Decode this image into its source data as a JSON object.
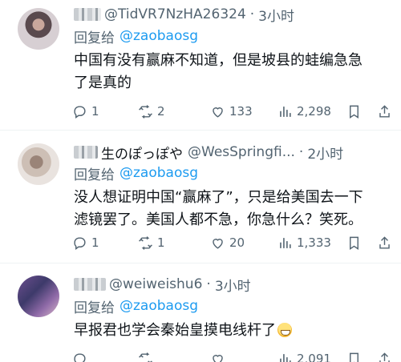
{
  "tweets": [
    {
      "display_name": "",
      "handle": "@TidVR7NzHA26324",
      "dot": "·",
      "time": "3小时",
      "reply_prefix": "回复给",
      "reply_to": "@zaobaosg",
      "text_line1": "中国有没有赢麻不知道，但是坡县的蛙编急急",
      "text_line2": "了是真的",
      "replies": "1",
      "retweets": "2",
      "likes": "133",
      "views": "2,298"
    },
    {
      "display_name": "生のぽっぽや",
      "handle": "@WesSpringfi...",
      "dot": "·",
      "time": "2小时",
      "reply_prefix": "回复给",
      "reply_to": "@zaobaosg",
      "text_line1": "没人想证明中国“赢麻了”，只是给美国去一下",
      "text_line2": "滤镜罢了。美国人都不急，你急什么？笑死。",
      "replies": "1",
      "retweets": "1",
      "likes": "20",
      "views": "1,333"
    },
    {
      "display_name": "",
      "handle": "@weiweishu6",
      "dot": "·",
      "time": "3小时",
      "reply_prefix": "回复给",
      "reply_to": "@zaobaosg",
      "text_line1": "早报君也学会秦始皇摸电线杆了",
      "text_line2": "",
      "replies": "",
      "retweets": "",
      "likes": "",
      "views": "2,091"
    }
  ],
  "icons": {
    "reply": "reply-icon",
    "retweet": "retweet-icon",
    "like": "heart-icon",
    "views": "views-icon",
    "bookmark": "bookmark-icon",
    "share": "share-icon",
    "emoji": "grinning-face-emoji"
  },
  "colors": {
    "link": "#1d9bf0",
    "secondary": "#536471",
    "text": "#0f1419"
  }
}
